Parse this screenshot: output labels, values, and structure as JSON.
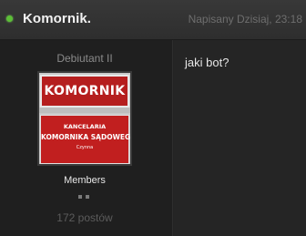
{
  "post": {
    "author": "Komornik.",
    "date": "Napisany Dzisiaj, 23:18",
    "content": "jaki bot?"
  },
  "author_info": {
    "rank": "Debiutant II",
    "group": "Members",
    "post_count": "172 postów",
    "avatar_text": {
      "title": "KOMORNIK",
      "line1": "KANCELARIA",
      "line2": "KOMORNIKA SĄDOWEGO",
      "line3": "Czynna"
    }
  },
  "colors": {
    "online": "#5cbf37",
    "sign_red": "#b51e1e"
  },
  "icons": {
    "status": "online-indicator-icon",
    "rank": "rank-pips-icon"
  }
}
